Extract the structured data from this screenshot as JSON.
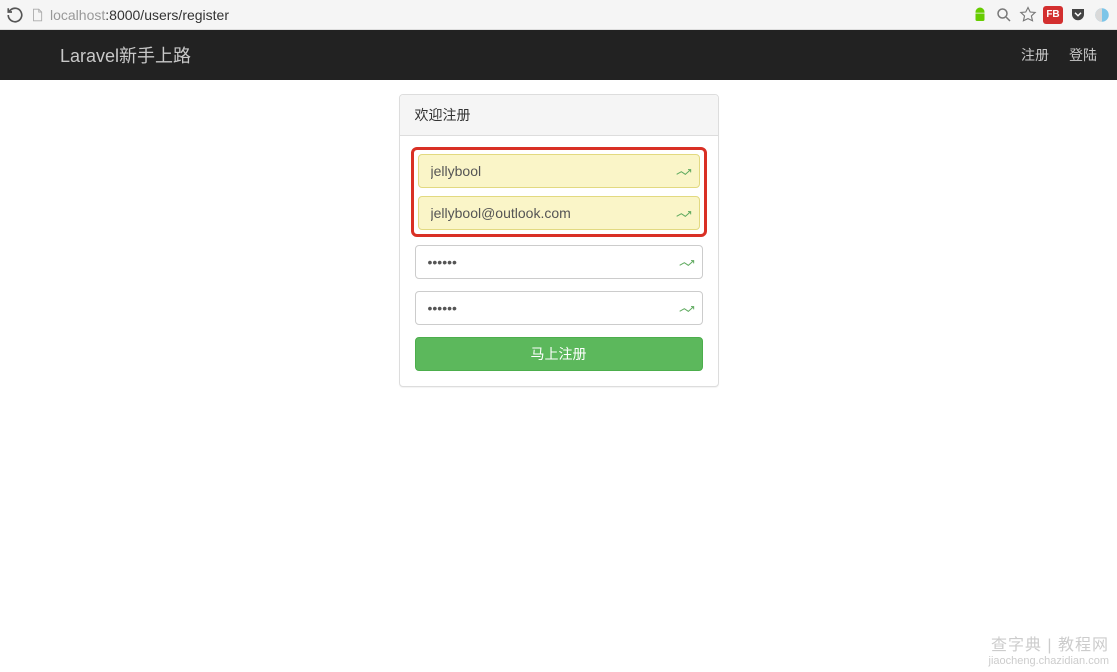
{
  "browser": {
    "url_host": "localhost",
    "url_port_path": ":8000/users/register",
    "icons": {
      "reload": "reload-icon",
      "page": "page-icon",
      "android": "android-icon",
      "zoom": "zoom-icon",
      "star": "star-icon",
      "fb_label": "FB",
      "pocket": "pocket-icon",
      "shield": "shield-icon"
    }
  },
  "navbar": {
    "brand": "Laravel新手上路",
    "links": {
      "register": "注册",
      "login": "登陆"
    }
  },
  "panel": {
    "title": "欢迎注册",
    "fields": {
      "username": {
        "value": "jellybool"
      },
      "email": {
        "value": "jellybool@outlook.com"
      },
      "password": {
        "value": "••••••"
      },
      "password_confirm": {
        "value": "••••••"
      }
    },
    "submit_label": "马上注册"
  },
  "watermark": {
    "line1": "查字典 | 教程网",
    "line2": "jiaocheng.chazidian.com"
  }
}
